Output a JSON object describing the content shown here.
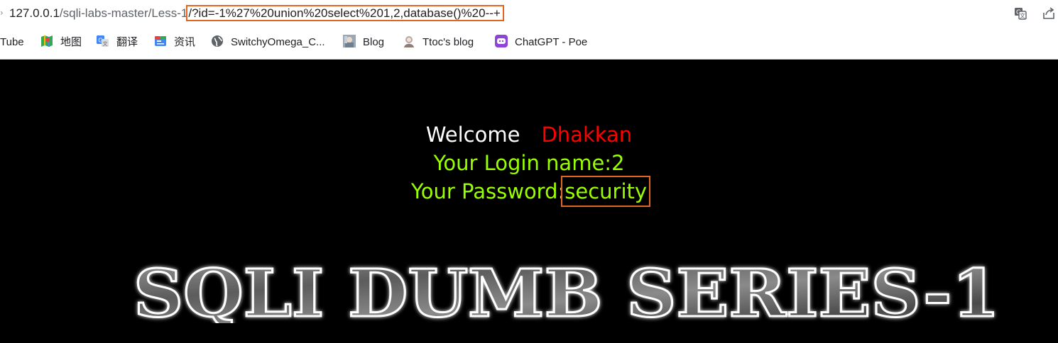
{
  "browser": {
    "url_host": "127.0.0.1",
    "url_path": "/sqli-labs-master/Less-1",
    "url_query": "/?id=-1%27%20union%20select%201,2,database()%20--+",
    "translate_icon": "translate-icon",
    "share_icon": "share-icon"
  },
  "bookmarks": [
    {
      "label": "Tube",
      "icon": "youtube-icon"
    },
    {
      "label": "地图",
      "icon": "maps-icon"
    },
    {
      "label": "翻译",
      "icon": "translate-icon"
    },
    {
      "label": "资讯",
      "icon": "news-icon"
    },
    {
      "label": "SwitchyOmega_C...",
      "icon": "globe-icon"
    },
    {
      "label": "Blog",
      "icon": "blog-avatar-icon"
    },
    {
      "label": "Ttoc's blog",
      "icon": "ttoc-avatar-icon"
    },
    {
      "label": "ChatGPT - Poe",
      "icon": "poe-icon"
    }
  ],
  "page": {
    "welcome": "Welcome",
    "name": "Dhakkan",
    "login_label": "Your Login name:",
    "login_value": "2",
    "password_label": "Your Password:",
    "password_value": "security",
    "banner_text": "SQLI DUMB SERIES-1"
  },
  "colors": {
    "accent_highlight": "#e2661f",
    "green_text": "#99ff00",
    "name_red": "#ff0000"
  }
}
